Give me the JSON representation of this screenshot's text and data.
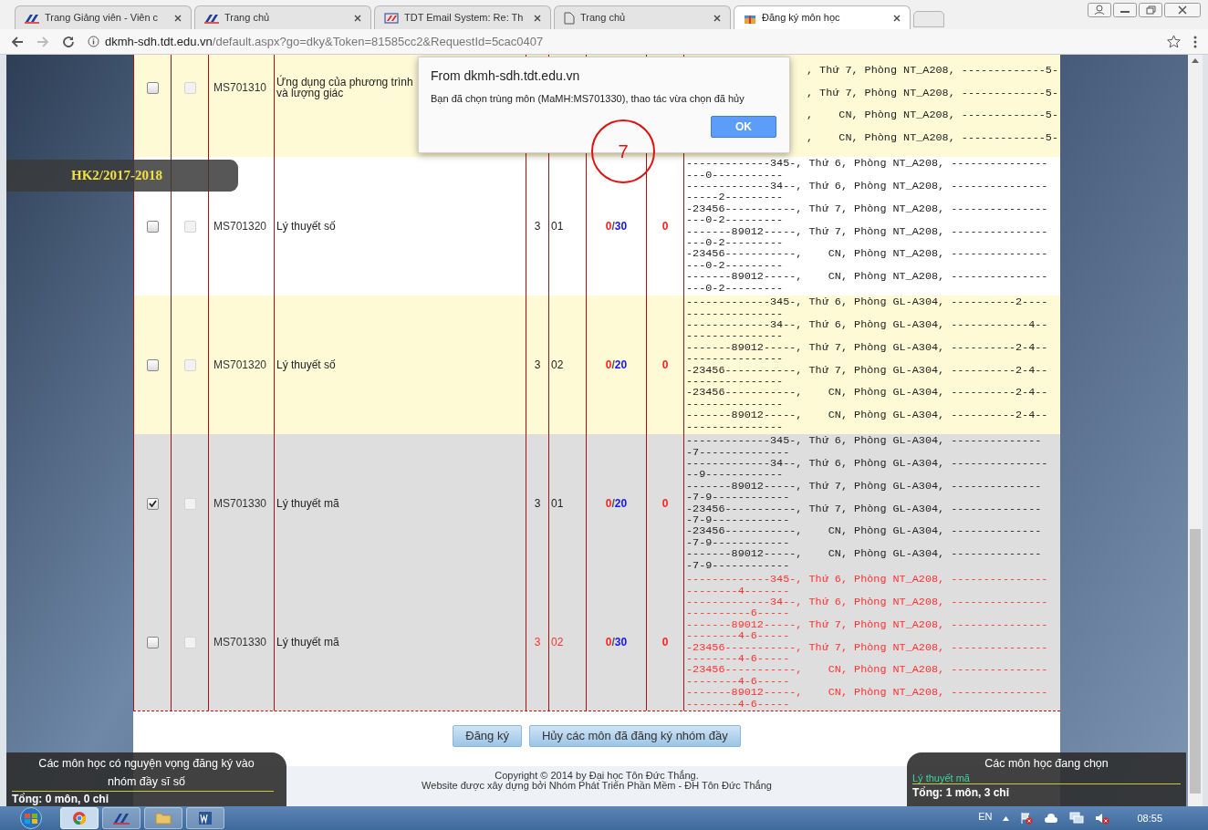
{
  "browser": {
    "tabs": [
      {
        "title": "Trang Giảng viên - Viên c",
        "selected": false
      },
      {
        "title": "Trang chủ",
        "selected": false
      },
      {
        "title": "TDT Email System: Re: Th",
        "selected": false
      },
      {
        "title": "Trang chủ",
        "selected": false
      },
      {
        "title": "Đăng ký môn học",
        "selected": true
      }
    ],
    "url_host": "dkmh-sdh.tdt.edu.vn",
    "url_path": "/default.aspx?go=dky&Token=81585cc2&RequestId=5cac0407"
  },
  "semester": "HK2/2017-2018",
  "courses": [
    {
      "kind": "highlight",
      "checked": false,
      "waitlist_disabled": true,
      "code": "MS701310",
      "name": "Ứng dụng của phương trình và lượng giác",
      "schedule": [
        [
          ", Thứ 7, Phòng NT_A208, -------------5-"
        ],
        [
          ", Thứ 7, Phòng NT_A208, -------------5-"
        ],
        [
          ",    CN, Phòng NT_A208, -------------5-"
        ],
        [
          ",    CN, Phòng NT_A208, -------------5-"
        ]
      ]
    },
    {
      "kind": "plain",
      "checked": false,
      "waitlist_disabled": true,
      "code": "MS701320",
      "name": "Lý thuyết số",
      "credits": "3",
      "group": "01",
      "slots": [
        "0",
        "/",
        "30"
      ],
      "waiting": "0",
      "conflict": false,
      "schedule": [
        [
          "-------------345-, Thứ 6, Phòng NT_A208, ---------------",
          "---0-----------"
        ],
        [
          "-------------34--, Thứ 6, Phòng NT_A208, ---------------",
          "-----2---------"
        ],
        [
          "-23456-----------, Thứ 7, Phòng NT_A208, ---------------",
          "---0-2---------"
        ],
        [
          "-------89012-----, Thứ 7, Phòng NT_A208, ---------------",
          "---0-2---------"
        ],
        [
          "-23456-----------,    CN, Phòng NT_A208, ---------------",
          "---0-2---------"
        ],
        [
          "-------89012-----,    CN, Phòng NT_A208, ---------------",
          "---0-2---------"
        ]
      ]
    },
    {
      "kind": "highlight",
      "checked": false,
      "waitlist_disabled": true,
      "code": "MS701320",
      "name": "Lý thuyết số",
      "credits": "3",
      "group": "02",
      "slots": [
        "0",
        "/",
        "20"
      ],
      "waiting": "0",
      "conflict": false,
      "schedule": [
        [
          "-------------345-, Thứ 6, Phòng GL-A304, ----------2----",
          "---------------"
        ],
        [
          "-------------34--, Thứ 6, Phòng GL-A304, ------------4--",
          "---------------"
        ],
        [
          "-------89012-----, Thứ 7, Phòng GL-A304, ----------2-4--",
          "---------------"
        ],
        [
          "-23456-----------, Thứ 7, Phòng GL-A304, ----------2-4--",
          "---------------"
        ],
        [
          "-23456-----------,    CN, Phòng GL-A304, ----------2-4--",
          "---------------"
        ],
        [
          "-------89012-----,    CN, Phòng GL-A304, ----------2-4--",
          "---------------"
        ]
      ]
    },
    {
      "kind": "chosen",
      "checked": true,
      "waitlist_disabled": true,
      "code": "MS701330",
      "name": "Lý thuyết mã",
      "credits": "3",
      "group": "01",
      "slots": [
        "0",
        "/",
        "20"
      ],
      "waiting": "0",
      "conflict": false,
      "schedule": [
        [
          "-------------345-, Thứ 6, Phòng GL-A304, --------------",
          "-7--------------"
        ],
        [
          "-------------34--, Thứ 6, Phòng GL-A304, ---------------",
          "--9------------"
        ],
        [
          "-------89012-----, Thứ 7, Phòng GL-A304, --------------",
          "-7-9------------"
        ],
        [
          "-23456-----------, Thứ 7, Phòng GL-A304, --------------",
          "-7-9------------"
        ],
        [
          "-23456-----------,    CN, Phòng GL-A304, --------------",
          "-7-9------------"
        ],
        [
          "-------89012-----,    CN, Phòng GL-A304, --------------",
          "-7-9------------"
        ]
      ]
    },
    {
      "kind": "chosen",
      "checked": false,
      "waitlist_disabled": true,
      "code": "MS701330",
      "name": "Lý thuyết mã",
      "credits": "3",
      "group": "02",
      "slots": [
        "0",
        "/",
        "30"
      ],
      "waiting": "0",
      "conflict": true,
      "schedule": [
        [
          "-------------345-, Thứ 6, Phòng NT_A208, ---------------",
          "--------4-------"
        ],
        [
          "-------------34--, Thứ 6, Phòng NT_A208, ---------------",
          "----------6-----"
        ],
        [
          "-------89012-----, Thứ 7, Phòng NT_A208, ---------------",
          "--------4-6-----"
        ],
        [
          "-23456-----------, Thứ 7, Phòng NT_A208, ---------------",
          "--------4-6-----"
        ],
        [
          "-23456-----------,    CN, Phòng NT_A208, ---------------",
          "--------4-6-----"
        ],
        [
          "-------89012-----,    CN, Phòng NT_A208, ---------------",
          "--------4-6-----"
        ]
      ]
    }
  ],
  "buttons": [
    "Đăng ký",
    "Hủy các môn đã đăng ký nhóm đầy"
  ],
  "footer": [
    "Copyright © 2014 by Đại học Tôn Đức Thắng.",
    "Website được xây dựng bởi Nhóm Phát Triển Phần Mềm - ĐH Tôn Đức Thắng"
  ],
  "full_group_panel": {
    "title": "Các môn học có nguyện vọng đăng ký vào nhóm đầy sĩ số",
    "total": "Tổng: 0 môn, 0 chỉ"
  },
  "selected_panel": {
    "title": "Các môn học đang chọn",
    "items": [
      "Lý thuyết mã"
    ],
    "total": "Tổng: 1 môn, 3 chỉ"
  },
  "dialog": {
    "title": "From dkmh-sdh.tdt.edu.vn",
    "message": "Bạn đã chọn trùng môn (MaMH:MS701330), thao tác vừa chọn đã hủy",
    "button": "OK"
  },
  "annotation": {
    "label": "7"
  },
  "taskbar": {
    "apps": [
      {
        "kind": "chrome",
        "selected": true
      },
      {
        "kind": "app",
        "selected": false
      },
      {
        "kind": "folder",
        "selected": false
      },
      {
        "kind": "word",
        "selected": false
      }
    ],
    "language": "EN",
    "clock": "08:55"
  }
}
